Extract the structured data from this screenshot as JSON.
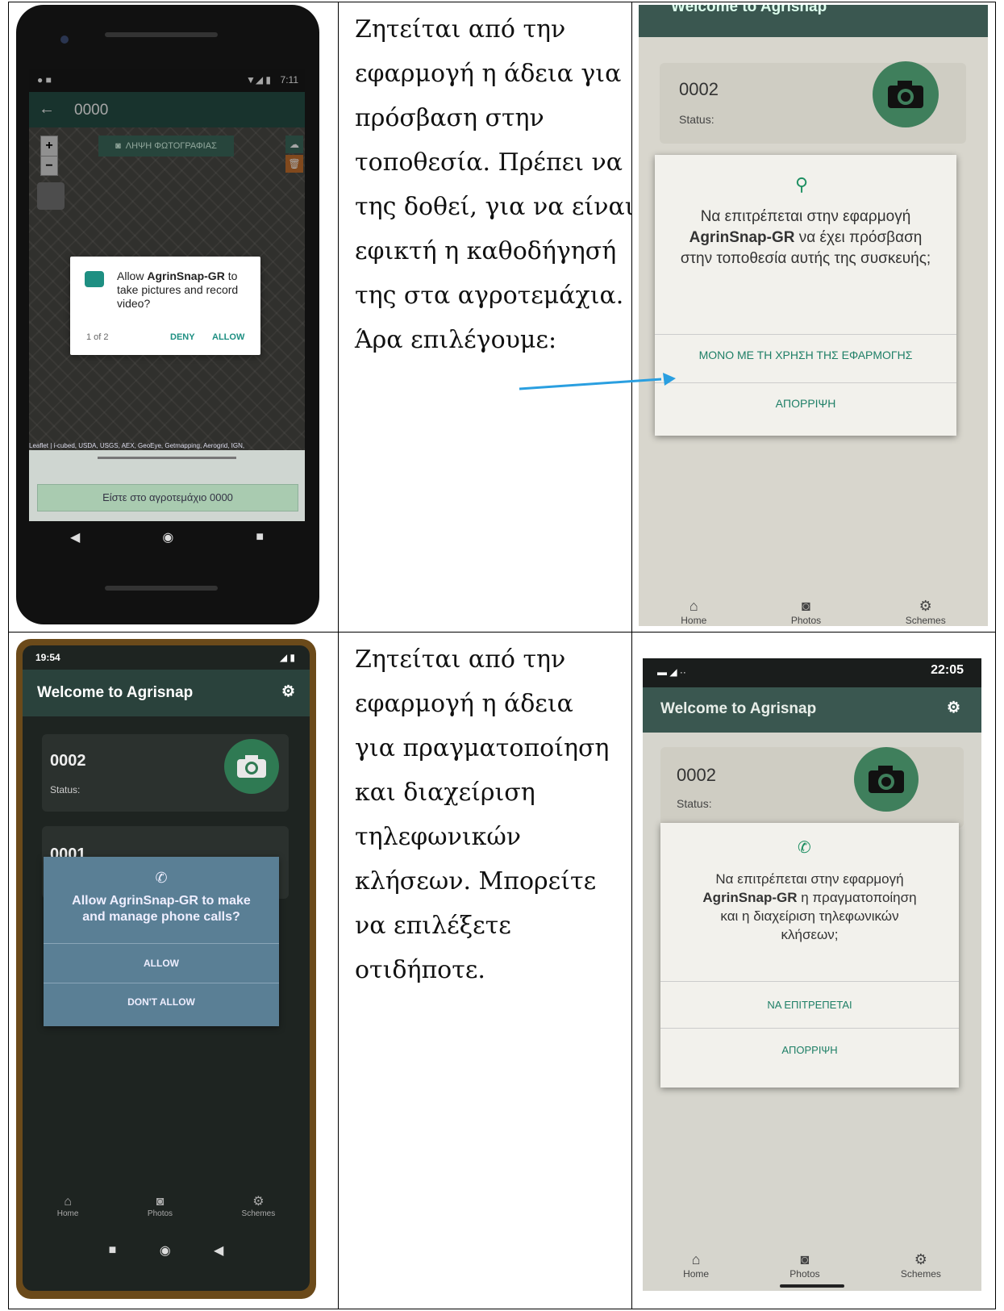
{
  "row1": {
    "phone1": {
      "status_time": "7:11",
      "title": "0000",
      "photo_button": "ΛΗΨΗ ΦΩΤΟΓΡΑΦΙΑΣ",
      "zoom_in": "+",
      "zoom_out": "−",
      "dialog": {
        "text_pre": "Allow ",
        "app": "AgrinSnap-GR",
        "text_post": " to take pictures and record video?",
        "counter": "1 of 2",
        "deny": "DENY",
        "allow": "ALLOW"
      },
      "attribution": "Leaflet | i-cubed, USDA, USGS, AEX, GeoEye, Getmapping, Aerogrid, IGN,",
      "field_button": "Είστε στο αγροτεμάχιο 0000"
    },
    "text_lines": [
      "Ζητείται από την",
      "εφαρμογή η άδεια για",
      "πρόσβαση στην",
      "τοποθεσία. Πρέπει να",
      "της δοθεί, για να είναι",
      "εφικτή η καθοδήγησή",
      "της στα αγροτεμάχια.",
      "Άρα επιλέγουμε:"
    ],
    "phone2": {
      "header_partial": "Welcome to Agrisnap",
      "card_id": "0002",
      "card_status": "Status:",
      "dialog": {
        "text1": "Να επιτρέπεται στην εφαρμογή ",
        "app": "AgrinSnap-GR",
        "text2": " να έχει πρόσβαση στην τοποθεσία αυτής της συσκευής;",
        "option1": "ΜΟΝΟ ΜΕ ΤΗ ΧΡΗΣΗ ΤΗΣ ΕΦΑΡΜΟΓΗΣ",
        "option2": "ΑΠΟΡΡΙΨΗ"
      },
      "tabs": [
        "Home",
        "Photos",
        "Schemes"
      ]
    }
  },
  "row2": {
    "phone3": {
      "status_time": "19:54",
      "title": "Welcome to Agrisnap",
      "card1_id": "0002",
      "card1_status": "Status:",
      "card2_id": "0001",
      "dialog": {
        "question": "Allow AgrinSnap-GR to make and manage phone calls?",
        "allow": "ALLOW",
        "deny": "DON'T ALLOW"
      },
      "tabs": [
        "Home",
        "Photos",
        "Schemes"
      ]
    },
    "text_lines": [
      "Ζητείται από την",
      "εφαρμογή η άδεια",
      "για πραγματοποίηση",
      "και διαχείριση",
      "τηλεφωνικών",
      "κλήσεων. Μπορείτε",
      "να επιλέξετε",
      "οτιδήποτε."
    ],
    "phone4": {
      "status_time": "22:05",
      "title": "Welcome to Agrisnap",
      "card_id": "0002",
      "card_status": "Status:",
      "dialog": {
        "text1": "Να επιτρέπεται στην εφαρμογή ",
        "app": "AgrinSnap-GR",
        "text2": " η πραγματοποίηση και η διαχείριση τηλεφωνικών κλήσεων;",
        "option1": "ΝΑ ΕΠΙΤΡΕΠΕΤΑΙ",
        "option2": "ΑΠΟΡΡΙΨΗ"
      },
      "tabs": [
        "Home",
        "Photos",
        "Schemes"
      ]
    }
  }
}
